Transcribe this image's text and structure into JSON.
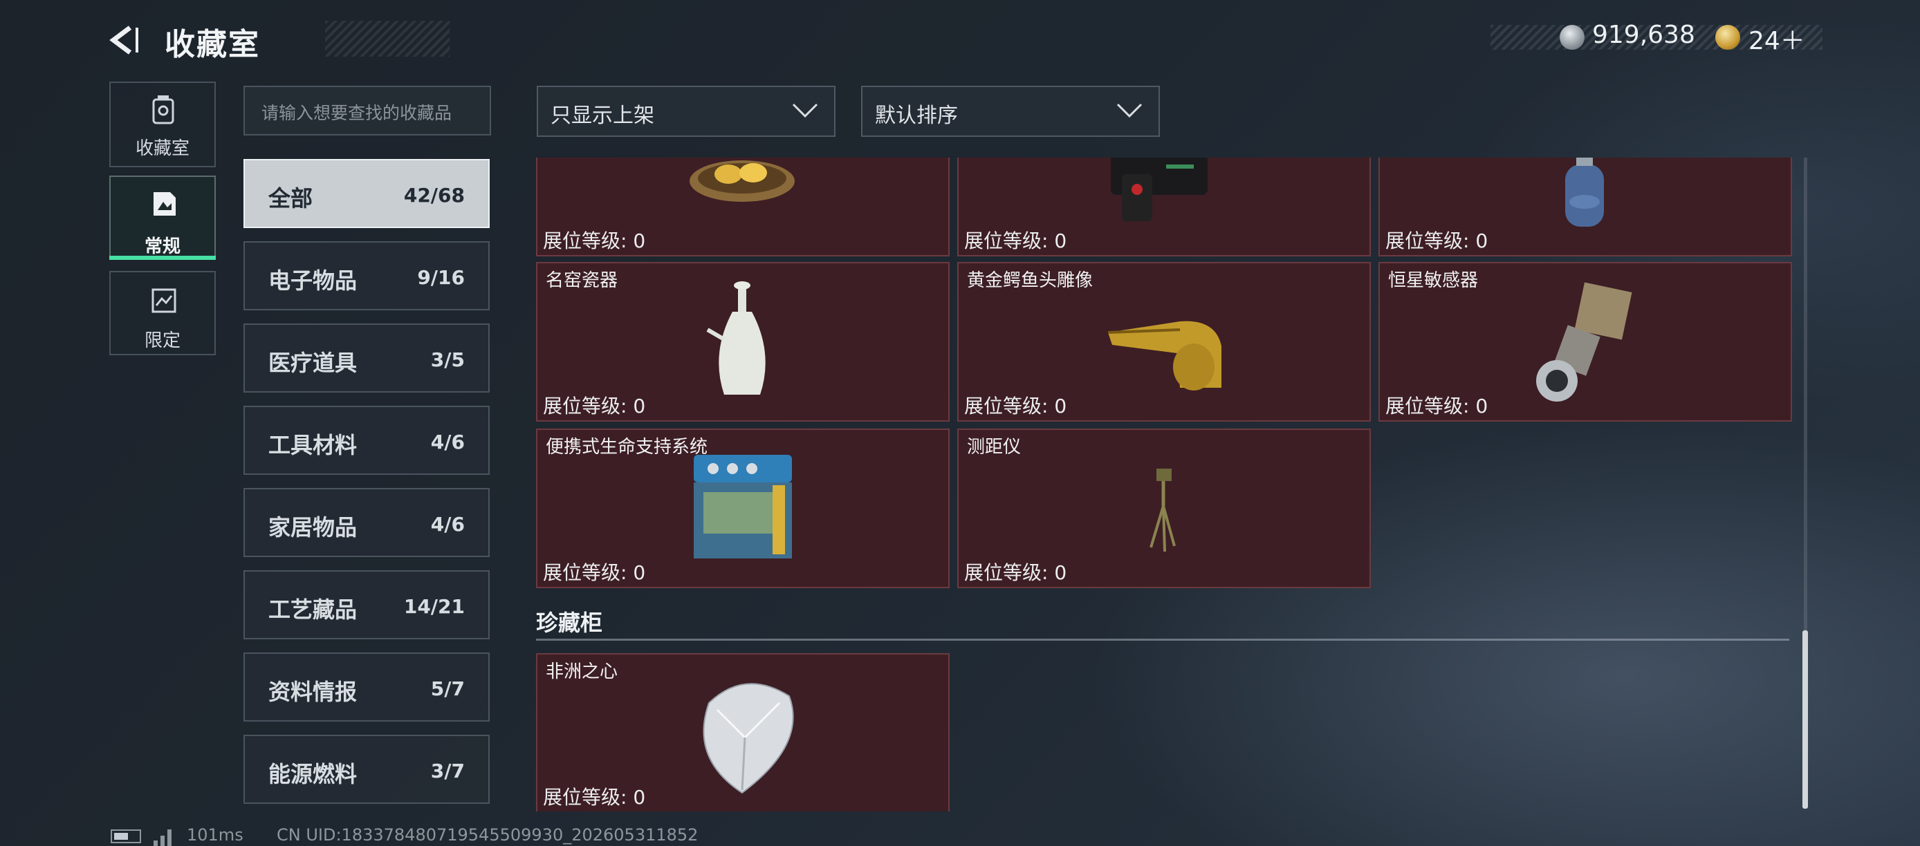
{
  "header": {
    "title": "收藏室",
    "silver_amount": "919,638",
    "gold_amount": "24＋"
  },
  "left_tabs": [
    {
      "label": "收藏室",
      "icon": "trash-bin-icon"
    },
    {
      "label": "常规",
      "icon": "regular-collection-icon",
      "selected": true
    },
    {
      "label": "限定",
      "icon": "limited-collection-icon"
    }
  ],
  "search": {
    "placeholder": "请输入想要查找的收藏品"
  },
  "filters": {
    "shelf_filter": "只显示上架",
    "sort_order": "默认排序"
  },
  "categories": [
    {
      "name": "全部",
      "count": "42/68",
      "selected": true
    },
    {
      "name": "电子物品",
      "count": "9/16"
    },
    {
      "name": "医疗道具",
      "count": "3/5"
    },
    {
      "name": "工具材料",
      "count": "4/6"
    },
    {
      "name": "家居物品",
      "count": "4/6"
    },
    {
      "name": "工艺藏品",
      "count": "14/21"
    },
    {
      "name": "资料情报",
      "count": "5/7"
    },
    {
      "name": "能源燃料",
      "count": "3/7"
    }
  ],
  "items": [
    {
      "name": "",
      "level_label": "展位等级:",
      "level": "0",
      "art": "golden-egg-nest"
    },
    {
      "name": "",
      "level_label": "展位等级:",
      "level": "0",
      "art": "black-device"
    },
    {
      "name": "",
      "level_label": "展位等级:",
      "level": "0",
      "art": "gas-canister"
    },
    {
      "name": "名窑瓷器",
      "level_label": "展位等级:",
      "level": "0",
      "art": "porcelain-vase"
    },
    {
      "name": "黄金鳄鱼头雕像",
      "level_label": "展位等级:",
      "level": "0",
      "art": "gold-crocodile-head"
    },
    {
      "name": "恒星敏感器",
      "level_label": "展位等级:",
      "level": "0",
      "art": "star-sensor"
    },
    {
      "name": "便携式生命支持系统",
      "level_label": "展位等级:",
      "level": "0",
      "art": "life-support-system"
    },
    {
      "name": "测距仪",
      "level_label": "展位等级:",
      "level": "0",
      "art": "rangefinder-tripod"
    }
  ],
  "treasure_section": {
    "title": "珍藏柜",
    "items": [
      {
        "name": "非洲之心",
        "level_label": "展位等级:",
        "level": "0",
        "art": "diamond"
      }
    ]
  },
  "status_bar": {
    "ping": "101ms",
    "uid": "CN UID:183378480719545509930_202605311852"
  }
}
